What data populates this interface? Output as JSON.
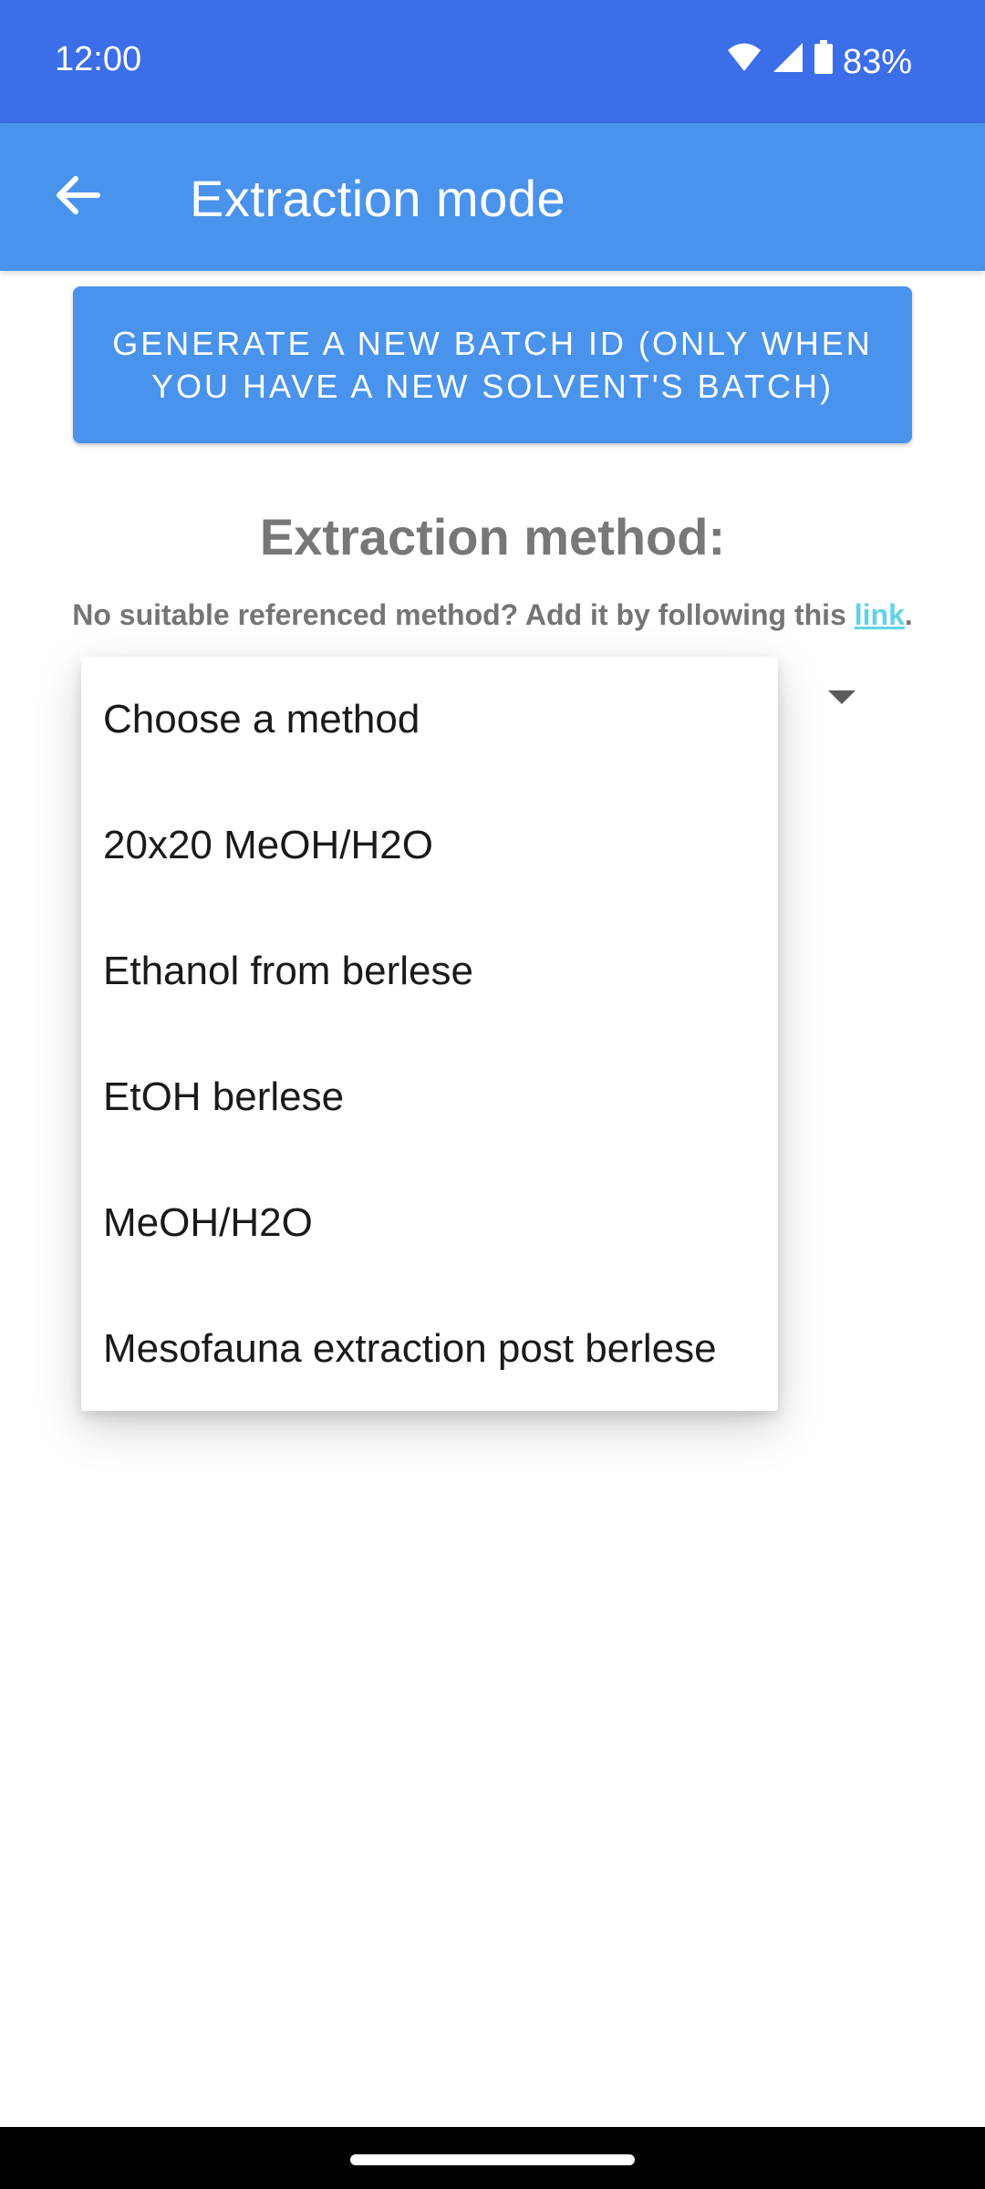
{
  "status_bar": {
    "time": "12:00",
    "battery": "83%",
    "icons": [
      "wifi-icon",
      "signal-icon",
      "battery-icon"
    ]
  },
  "app_bar": {
    "title": "Extraction mode",
    "back_icon": "arrow-left-icon"
  },
  "generate_button": {
    "label": "GENERATE A  NEW BATCH ID (ONLY WHEN YOU HAVE A NEW SOLVENT'S BATCH)"
  },
  "section": {
    "title": "Extraction method:",
    "hint_prefix": "No suitable referenced method? Add it by following this ",
    "hint_link": "link",
    "hint_suffix": "."
  },
  "dropdown": {
    "options": [
      "Choose a method",
      "20x20 MeOH/H2O",
      "Ethanol from berlese",
      "EtOH berlese",
      "MeOH/H2O",
      "Mesofauna extraction post berlese"
    ]
  },
  "colors": {
    "status_bar": "#3b6ee8",
    "app_bar": "#4a93ec",
    "link": "#5fd3e6"
  }
}
